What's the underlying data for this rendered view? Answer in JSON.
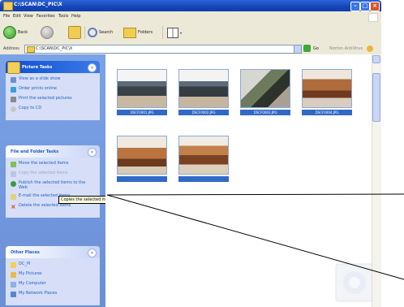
{
  "window": {
    "title": "C:\\SCAN\\DC_PIC\\X"
  },
  "menu": [
    "File",
    "Edit",
    "View",
    "Favorites",
    "Tools",
    "Help"
  ],
  "toolbar": {
    "back_label": "Back",
    "search_label": "Search",
    "folders_label": "Folders"
  },
  "address": {
    "label": "Address",
    "path": "C:\\SCAN\\DC_PIC\\X",
    "go_label": "Go",
    "links_label": "Norton AntiVirus"
  },
  "picture_tasks": {
    "title": "Picture Tasks",
    "items": [
      "View as a slide show",
      "Order prints online",
      "Print the selected pictures",
      "Copy to CD"
    ]
  },
  "file_tasks": {
    "title": "File and Folder Tasks",
    "items": [
      "Move the selected items",
      "Copy the selected items",
      "Publish the selected items to the Web",
      "E-mail the selected items",
      "Delete the selected items"
    ]
  },
  "tooltip": "Copies the selected items to",
  "other_places": {
    "title": "Other Places",
    "items": [
      "DC_PI",
      "My Pictures",
      "My Computer",
      "My Network Places"
    ]
  },
  "thumbnails": [
    {
      "caption": "DSCF0001.JPG",
      "selected": true
    },
    {
      "caption": "DSCF0002.JPG",
      "selected": true
    },
    {
      "caption": "DSCF0003.JPG",
      "selected": true
    },
    {
      "caption": "DSCF0004.JPG",
      "selected": true
    },
    {
      "caption": "",
      "selected": true
    },
    {
      "caption": "",
      "selected": true
    }
  ],
  "colors": {
    "titlebar": "#1546b8",
    "taskpane_bg": "#6b8fd6",
    "selection": "#316ac5",
    "link_text": "#215dc6"
  }
}
